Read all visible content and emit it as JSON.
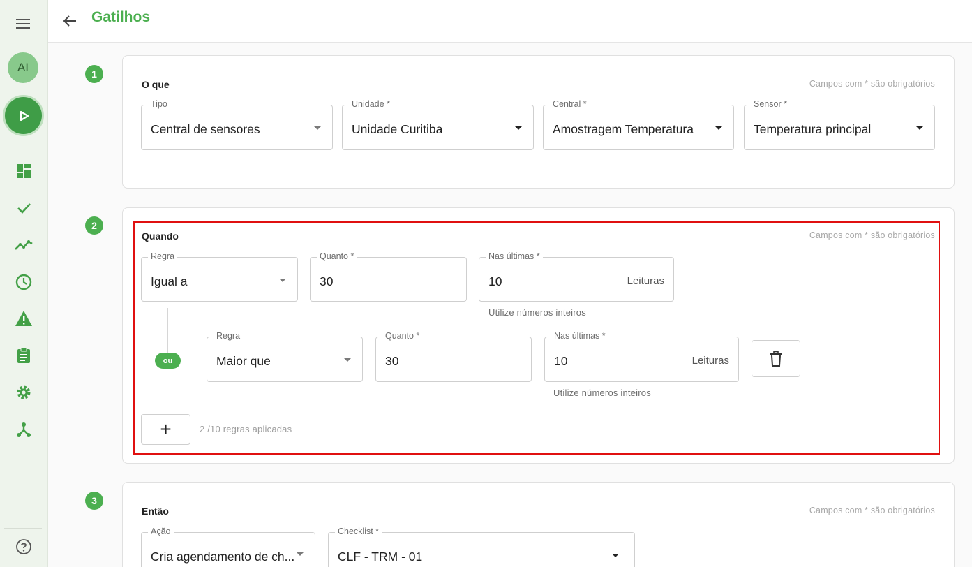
{
  "header": {
    "title": "Gatilhos"
  },
  "sidebar": {
    "avatar_initials": "AI"
  },
  "steps": [
    "1",
    "2",
    "3"
  ],
  "step1": {
    "title": "O que",
    "required_note": "Campos com * são obrigatórios",
    "fields": {
      "tipo": {
        "label": "Tipo",
        "value": "Central de sensores"
      },
      "unidade": {
        "label": "Unidade *",
        "value": "Unidade Curitiba"
      },
      "central": {
        "label": "Central *",
        "value": "Amostragem Temperatura"
      },
      "sensor": {
        "label": "Sensor *",
        "value": "Temperatura principal"
      }
    }
  },
  "step2": {
    "title": "Quando",
    "required_note": "Campos com * são obrigatórios",
    "rules": [
      {
        "regra_label": "Regra",
        "regra_value": "Igual a",
        "quanto_label": "Quanto *",
        "quanto_value": "30",
        "nas_label": "Nas últimas *",
        "nas_value": "10",
        "nas_suffix": "Leituras",
        "helper": "Utilize números inteiros"
      },
      {
        "regra_label": "Regra",
        "regra_value": "Maior que",
        "quanto_label": "Quanto *",
        "quanto_value": "30",
        "nas_label": "Nas últimas *",
        "nas_value": "10",
        "nas_suffix": "Leituras",
        "helper": "Utilize números inteiros"
      }
    ],
    "or_label": "ou",
    "add_label": "+",
    "rules_count": "2 /10 regras aplicadas"
  },
  "step3": {
    "title": "Então",
    "required_note": "Campos com * são obrigatórios",
    "fields": {
      "acao": {
        "label": "Ação",
        "value": "Cria agendamento de ch..."
      },
      "checklist": {
        "label": "Checklist *",
        "value": "CLF - TRM - 01"
      }
    }
  },
  "colors": {
    "primary": "#4caf50",
    "highlight": "#e01010",
    "sidebar_bg": "#eef4ec"
  },
  "icons": [
    "menu-icon",
    "play-icon",
    "dashboard-icon",
    "check-icon",
    "trend-icon",
    "clock-icon",
    "warning-icon",
    "clipboard-icon",
    "gear-icon",
    "hierarchy-icon",
    "help-icon",
    "back-arrow-icon",
    "trash-icon",
    "chevron-down-icon"
  ]
}
